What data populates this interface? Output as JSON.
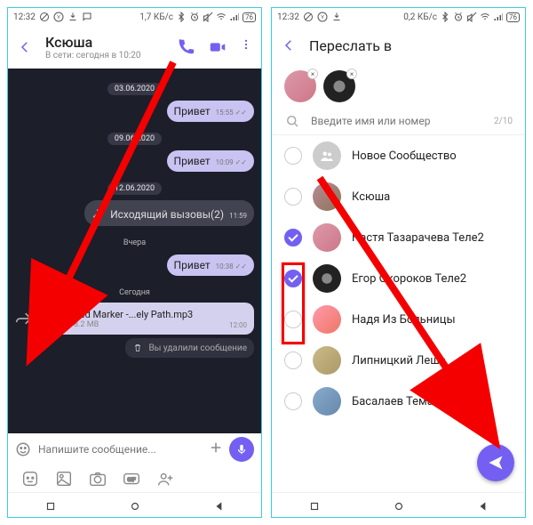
{
  "status": {
    "clock": "12:32",
    "speed_left": "1,7 КБ/с",
    "speed_right": "0,2 КБ/с",
    "battery": "76"
  },
  "chat": {
    "title": "Ксюша",
    "subtitle": "В сети: сегодня в 10:20",
    "composer_placeholder": "Напишите сообщение...",
    "dates": {
      "d1": "03.06.2020",
      "d2": "09.06.2020",
      "d3": "12.06.2020",
      "d4": "Вчера",
      "d5": "Сегодня"
    },
    "msgs": {
      "m1": {
        "text": "Привет",
        "time": "15:55"
      },
      "m2": {
        "text": "Привет",
        "time": "10:09"
      },
      "call": {
        "text": "Исходящий вызовы(2)",
        "time": "11:59"
      },
      "m3": {
        "text": "Привет",
        "time": "10:38"
      },
      "file": {
        "name": "Red Marker -...ely Path.mp3",
        "size": "8.2 MB",
        "time": "12:00"
      },
      "deleted": "Вы удалили сообщение"
    }
  },
  "forward": {
    "title": "Переслать в",
    "search_placeholder": "Введите имя или номер",
    "count": "2/10",
    "contacts": {
      "c0": "Новое Сообщество",
      "c1": "Ксюша",
      "c2": "Настя Тазарачева Теле2",
      "c3": "Егор Окороков Теле2",
      "c4": "Надя Из Больницы",
      "c5": "Липницкий Леша",
      "c6": "Басалаев Тема"
    }
  }
}
